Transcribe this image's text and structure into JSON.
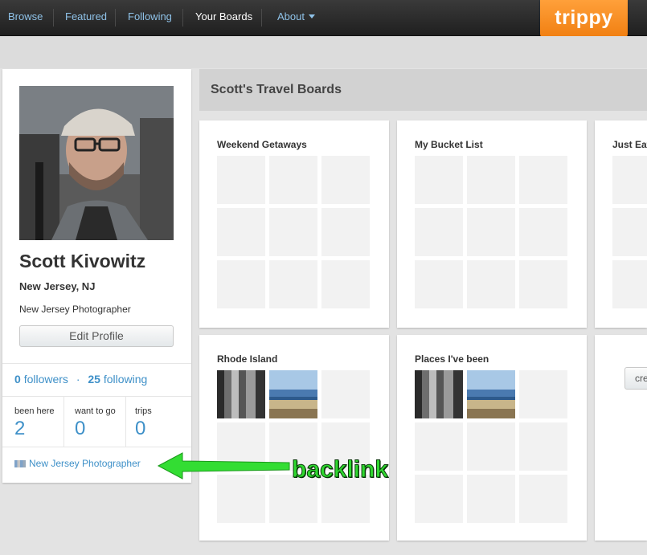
{
  "nav": {
    "items": [
      {
        "label": "Browse",
        "active": false
      },
      {
        "label": "Featured",
        "active": false
      },
      {
        "label": "Following",
        "active": false
      },
      {
        "label": "Your Boards",
        "active": true
      },
      {
        "label": "About",
        "active": false,
        "has_dropdown": true
      }
    ],
    "logo": "trippy"
  },
  "profile": {
    "name": "Scott Kivowitz",
    "location": "New Jersey, NJ",
    "tagline": "New Jersey Photographer",
    "edit_button": "Edit Profile",
    "followers_count": "0",
    "followers_label": "followers",
    "separator": "·",
    "following_count": "25",
    "following_label": "following",
    "stats": [
      {
        "label": "been here",
        "value": "2"
      },
      {
        "label": "want to go",
        "value": "0"
      },
      {
        "label": "trips",
        "value": "0"
      }
    ],
    "backlink_text": "New Jersey Photographer"
  },
  "boards": {
    "title": "Scott's Travel Boards",
    "items": [
      {
        "title": "Weekend Getaways"
      },
      {
        "title": "My Bucket List"
      },
      {
        "title": "Just Eat"
      },
      {
        "title": "Rhode Island"
      },
      {
        "title": "Places I've been"
      }
    ],
    "create_button": "cre"
  },
  "annotation": {
    "text": "backlink",
    "color": "#2fd82f"
  },
  "colors": {
    "link": "#3e90c8",
    "logo": "#f5891e",
    "nav_bg": "#2a2a2a"
  }
}
